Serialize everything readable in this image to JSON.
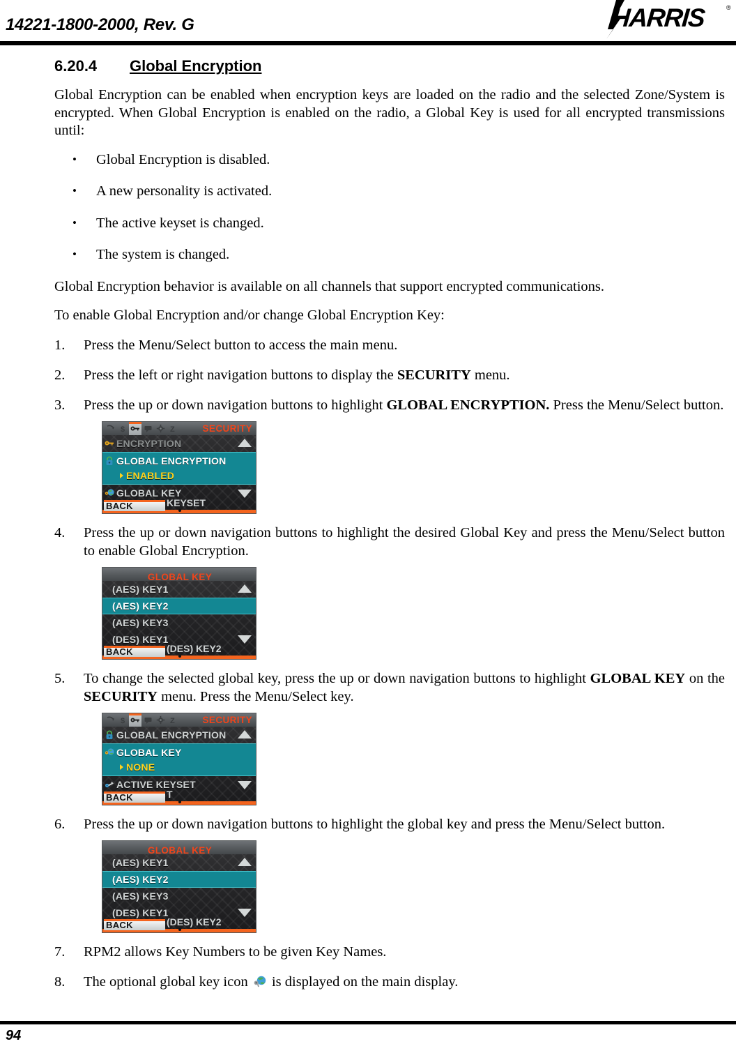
{
  "header": {
    "doc_number": "14221-1800-2000, Rev. G",
    "logo_text": "HARRIS",
    "logo_tm": "®"
  },
  "section": {
    "number": "6.20.4",
    "title": "Global Encryption"
  },
  "intro": {
    "paragraph": "Global Encryption can be enabled when encryption keys are loaded on the radio and the selected Zone/System is encrypted. When Global Encryption is enabled on the radio, a Global Key is used for all encrypted transmissions until:"
  },
  "bullets": [
    "Global Encryption is disabled.",
    "A new personality is activated.",
    "The active keyset is changed.",
    "The system is changed."
  ],
  "notes": {
    "behavior": "Global Encryption behavior is available on all channels that support encrypted communications.",
    "lead_in": "To enable Global Encryption and/or change Global Encryption Key:"
  },
  "steps": {
    "s1": "Press the Menu/Select button to access the main menu.",
    "s2_a": "Press the left or right navigation buttons to display the ",
    "s2_b": "SECURITY",
    "s2_c": " menu.",
    "s3_a": "Press the up or down navigation buttons to highlight ",
    "s3_b": "GLOBAL ENCRYPTION.",
    "s3_c": " Press the Menu/Select button.",
    "s4": "Press the up or down navigation buttons to highlight the desired Global Key and press the Menu/Select button to enable Global Encryption.",
    "s5_a": "To change the selected global key, press the up or down navigation buttons to highlight ",
    "s5_b": "GLOBAL KEY",
    "s5_c": " on the ",
    "s5_d": "SECURITY",
    "s5_e": " menu. Press the Menu/Select key.",
    "s6": "Press the up or down navigation buttons to highlight the global key and press the Menu/Select button.",
    "s7": "RPM2 allows Key Numbers to be given Key Names.",
    "s8_a": "The optional global key icon ",
    "s8_b": " is displayed on the main display."
  },
  "colors": {
    "accent_orange": "#f4641e",
    "title_orange": "#f0451b",
    "highlight_teal": "#138793",
    "highlight_border": "#46c3cc",
    "value_yellow": "#ffd21e",
    "lcd_text": "#cfd3d3"
  },
  "screens": {
    "security_encryption": {
      "title": "SECURITY",
      "tab_icons": [
        "call-icon",
        "dollar-icon",
        "key-icon",
        "message-icon",
        "gear-icon",
        "sleep-icon"
      ],
      "selected_tab_index": 2,
      "rows": [
        {
          "icon": "key-icon",
          "label": "ENCRYPTION",
          "state": "dim"
        },
        {
          "icon": "lock-icon",
          "label": "GLOBAL ENCRYPTION",
          "value": "ENABLED",
          "state": "highlighted"
        },
        {
          "icon": "globe-key-icon",
          "label": "GLOBAL KEY",
          "state": "normal"
        }
      ],
      "softkey": "BACK",
      "behind_text": "KEYSET",
      "scroll_up": true,
      "scroll_down": true
    },
    "global_key_list": {
      "title": "GLOBAL KEY",
      "rows": [
        {
          "label": "(AES) KEY1",
          "state": "normal"
        },
        {
          "label": "(AES) KEY2",
          "state": "selected"
        },
        {
          "label": "(AES) KEY3",
          "state": "normal"
        },
        {
          "label": "(DES) KEY1",
          "state": "normal"
        }
      ],
      "softkey": "BACK",
      "behind_text": "(DES) KEY2",
      "scroll_up": true,
      "scroll_down": true
    },
    "security_global_key": {
      "title": "SECURITY",
      "tab_icons": [
        "call-icon",
        "dollar-icon",
        "key-icon",
        "message-icon",
        "gear-icon",
        "sleep-icon"
      ],
      "selected_tab_index": 2,
      "rows": [
        {
          "icon": "lock-icon",
          "label": "GLOBAL ENCRYPTION",
          "state": "normal"
        },
        {
          "icon": "globe-key-icon",
          "label": "GLOBAL KEY",
          "value": "NONE",
          "state": "highlighted"
        },
        {
          "icon": "keyset-icon",
          "label": "ACTIVE KEYSET",
          "state": "normal"
        }
      ],
      "softkey": "BACK",
      "behind_text": "T",
      "scroll_up": true,
      "scroll_down": true
    },
    "global_key_list_2": {
      "title": "GLOBAL KEY",
      "rows": [
        {
          "label": "(AES) KEY1",
          "state": "normal"
        },
        {
          "label": "(AES) KEY2",
          "state": "selected"
        },
        {
          "label": "(AES) KEY3",
          "state": "normal"
        },
        {
          "label": "(DES) KEY1",
          "state": "normal"
        }
      ],
      "softkey": "BACK",
      "behind_text": "(DES) KEY2",
      "scroll_up": true,
      "scroll_down": true
    }
  },
  "footer": {
    "page_number": "94"
  }
}
